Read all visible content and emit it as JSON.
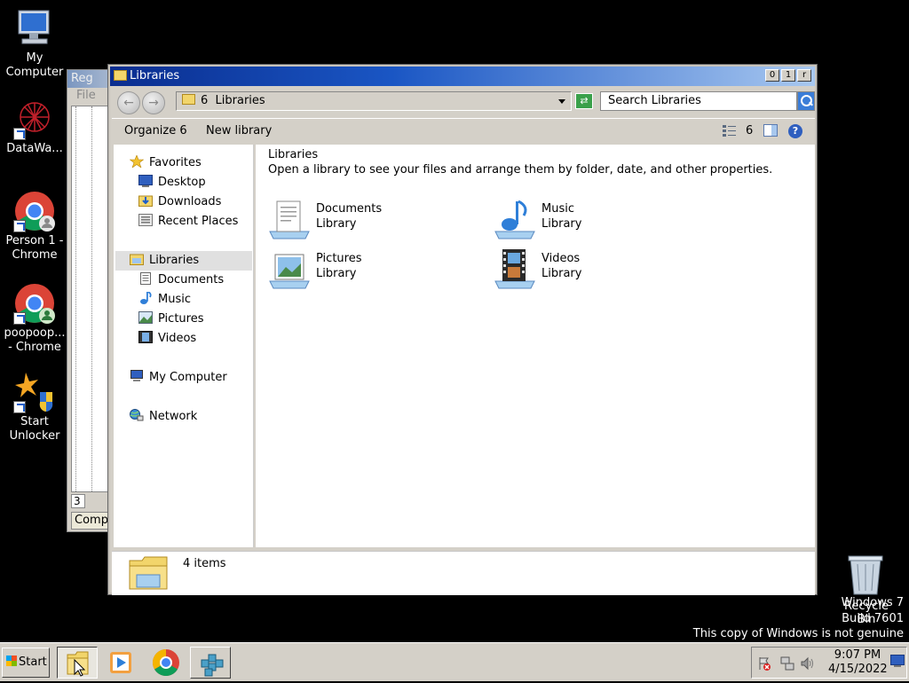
{
  "desktop": {
    "icons": [
      {
        "label": "My\nComputer"
      },
      {
        "label": "DataWa..."
      },
      {
        "label": "Person 1 -\nChrome"
      },
      {
        "label": "poopoop...\n- Chrome"
      },
      {
        "label": "Start\nUnlocker"
      }
    ],
    "recycle_bin_label": "Recycle\nBin",
    "watermark_line1": "Windows 7",
    "watermark_line2": "Build 7601",
    "watermark_line3": "This copy of Windows is not genuine"
  },
  "background_window": {
    "title": "Reg",
    "menu": "File",
    "number": "3",
    "status": "Compu"
  },
  "window": {
    "title": "Libraries",
    "buttons": {
      "minimize": "0",
      "maximize": "1",
      "close": "r"
    },
    "address": "6  Libraries",
    "search_placeholder": "Search Libraries",
    "organize": "Organize 6",
    "new_library": "New library",
    "view_count": "6",
    "help": "?",
    "nav": {
      "favorites": "Favorites",
      "desktop": "Desktop",
      "downloads": "Downloads",
      "recent_places": "Recent Places",
      "libraries": "Libraries",
      "documents": "Documents",
      "music": "Music",
      "pictures": "Pictures",
      "videos": "Videos",
      "my_computer": "My Computer",
      "network": "Network"
    },
    "content": {
      "title": "Libraries",
      "description": "Open a library to see your files and arrange them by folder, date, and other properties.",
      "libraries": [
        {
          "name": "Documents",
          "sub": "Library"
        },
        {
          "name": "Music",
          "sub": "Library"
        },
        {
          "name": "Pictures",
          "sub": "Library"
        },
        {
          "name": "Videos",
          "sub": "Library"
        }
      ]
    },
    "details": {
      "count": "4 items"
    }
  },
  "taskbar": {
    "start": "Start",
    "time": "9:07 PM",
    "date": "4/15/2022"
  }
}
